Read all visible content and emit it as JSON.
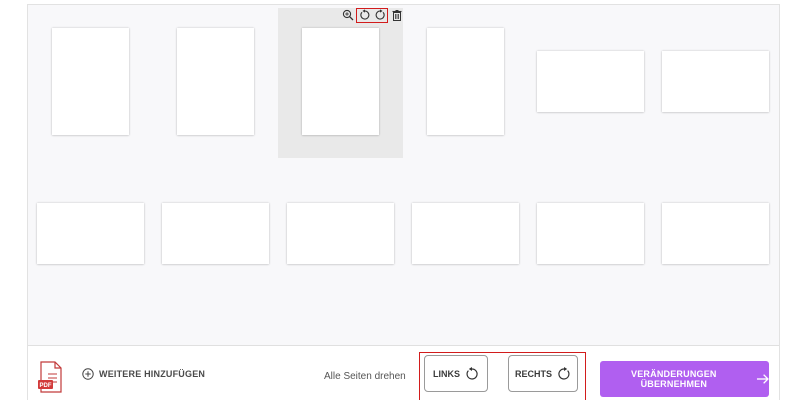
{
  "bottom_bar": {
    "add_more_label": "WEITERE HINZUFÜGEN",
    "rotate_all_label": "Alle Seiten drehen",
    "left_label": "LINKS",
    "right_label": "RECHTS",
    "apply_label": "VERÄNDERUNGEN ÜBERNEHMEN"
  },
  "pdf_badge": "PDF",
  "colors": {
    "accent": "#b05ff0",
    "highlight": "#d21c1c"
  },
  "icons": [
    "zoom-in-icon",
    "rotate-left-icon",
    "rotate-right-icon",
    "trash-icon",
    "pdf-file-icon",
    "plus-circle-icon",
    "arrow-right-icon"
  ]
}
